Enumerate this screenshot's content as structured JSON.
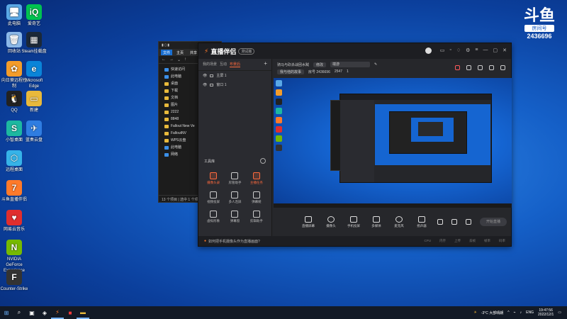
{
  "desktop": {
    "icons": [
      {
        "label": "此电脑",
        "glyph": "🖥",
        "color": "#5aa9e6"
      },
      {
        "label": "回收站",
        "glyph": "🗑",
        "color": "#8bb8e8"
      },
      {
        "label": "向日葵远程控制",
        "glyph": "✿",
        "color": "#f39c2a"
      },
      {
        "label": "QQ",
        "glyph": "🐧",
        "color": "#222"
      },
      {
        "label": "小智桌面",
        "glyph": "S",
        "color": "#1db8a0"
      },
      {
        "label": "远程桌面",
        "glyph": "⬡",
        "color": "#36b3e8"
      },
      {
        "label": "斗鱼直播伴侣",
        "glyph": "7",
        "color": "#ff7a2a"
      },
      {
        "label": "网易云音乐",
        "glyph": "♥",
        "color": "#e02e2e"
      },
      {
        "label": "NVIDIA GeForce Experience",
        "glyph": "N",
        "color": "#76b900"
      },
      {
        "label": "Counter-Strike",
        "glyph": "F",
        "color": "#333"
      }
    ],
    "icons_col2": [
      {
        "label": "爱奇艺",
        "glyph": "iQ",
        "color": "#00c250"
      },
      {
        "label": "Steam挂载盘",
        "glyph": "▦",
        "color": "#1b2838"
      },
      {
        "label": "Microsoft Edge",
        "glyph": "e",
        "color": "#0a84d8"
      },
      {
        "label": "新建",
        "glyph": "▭",
        "color": "#e8b93b"
      },
      {
        "label": "蓝奏云盘",
        "glyph": "✈",
        "color": "#2f7de1"
      }
    ]
  },
  "douyu": {
    "logo": "斗鱼",
    "room_label": "房间号",
    "room_number": "2436696"
  },
  "explorer": {
    "ribbon": [
      "文件",
      "主页",
      "共享"
    ],
    "nav_items": [
      "快速访问",
      "此电脑",
      "桌面",
      "下载",
      "文档",
      "图片",
      "2222",
      "8848",
      "Fallout New Ve",
      "FalloutNV",
      "WPS云盘",
      "此电脑",
      "网络"
    ],
    "status": "13 个项目 | 选中 1 个项目"
  },
  "app": {
    "name": "直播伴侣",
    "beta": "测试版",
    "tabs": [
      "我的场景",
      "互动",
      "布景后"
    ],
    "active_tab": 2,
    "scenes": [
      "主屏 1",
      "窗口 1"
    ],
    "tools_title": "工具库",
    "tools": [
      {
        "label": "摄像头录",
        "hot": true
      },
      {
        "label": "房管助手",
        "hot": false
      },
      {
        "label": "主播任务",
        "hot": true
      },
      {
        "label": "视频投屏",
        "hot": false
      },
      {
        "label": "多人连屏",
        "hot": false
      },
      {
        "label": "弹幕姬",
        "hot": false
      },
      {
        "label": "虚拟形象",
        "hot": false
      },
      {
        "label": "弹幕窗",
        "hot": false
      },
      {
        "label": "剪辑助手",
        "hot": false
      }
    ],
    "header": {
      "room_title": "骑马与砍杀战团水贼",
      "edit_label": "修改",
      "category": "端游",
      "announcement": "我与他的故事",
      "room_label": "房号 2436696",
      "followers": "2547",
      "viewers": "1"
    },
    "controls": [
      {
        "label": "直播屏幕",
        "round": false
      },
      {
        "label": "摄像头",
        "round": true
      },
      {
        "label": "手机投屏",
        "round": false
      },
      {
        "label": "多媒体",
        "round": false
      },
      {
        "label": "麦克风",
        "round": true
      },
      {
        "label": "扬声器",
        "round": false
      }
    ],
    "start_live": "开始直播",
    "bottom_tip": "如何把手机摄像头作为直播画面?",
    "stats": [
      "CPU",
      "内存",
      "上传",
      "丢帧",
      "帧率",
      "码率"
    ]
  },
  "taskbar": {
    "weather": "-3°C 大部晴朗",
    "lang": "ENG",
    "time": "19:47:56",
    "date": "2022/12/1"
  }
}
